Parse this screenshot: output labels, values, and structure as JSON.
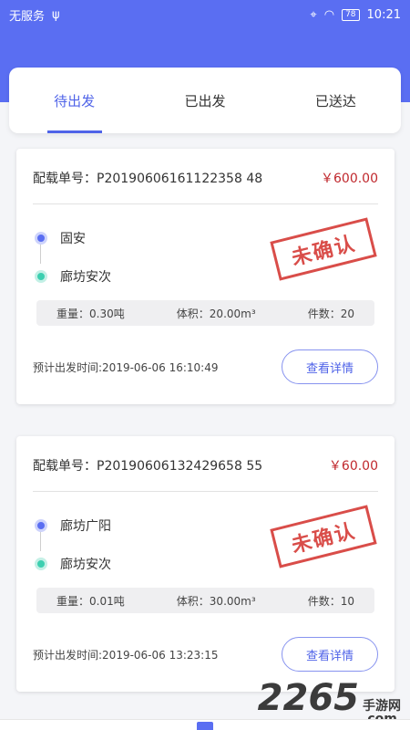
{
  "status_bar": {
    "carrier": "无服务",
    "battery": "78",
    "time": "10:21"
  },
  "tabs": [
    {
      "label": "待出发",
      "active": true
    },
    {
      "label": "已出发",
      "active": false
    },
    {
      "label": "已送达",
      "active": false
    }
  ],
  "orders": [
    {
      "order_no": "配载单号：P20190606161122358 48",
      "price": "￥600.00",
      "origin": "固安",
      "destination": "廊坊安次",
      "stamp": "未确认",
      "weight": "重量：0.30吨",
      "volume": "体积：20.00m³",
      "pieces": "件数：20",
      "depart_time": "预计出发时间:2019-06-06 16:10:49",
      "detail_button": "查看详情"
    },
    {
      "order_no": "配载单号：P20190606132429658 55",
      "price": "￥60.00",
      "origin": "廊坊广阳",
      "destination": "廊坊安次",
      "stamp": "未确认",
      "weight": "重量：0.01吨",
      "volume": "体积：30.00m³",
      "pieces": "件数：10",
      "depart_time": "预计出发时间:2019-06-06 13:23:15",
      "detail_button": "查看详情"
    }
  ],
  "watermark": {
    "number": "2265",
    "site": "手游网",
    "domain": ".com"
  },
  "colors": {
    "accent": "#5a6ef2",
    "price": "#c0282d",
    "stamp": "#d53a36"
  }
}
